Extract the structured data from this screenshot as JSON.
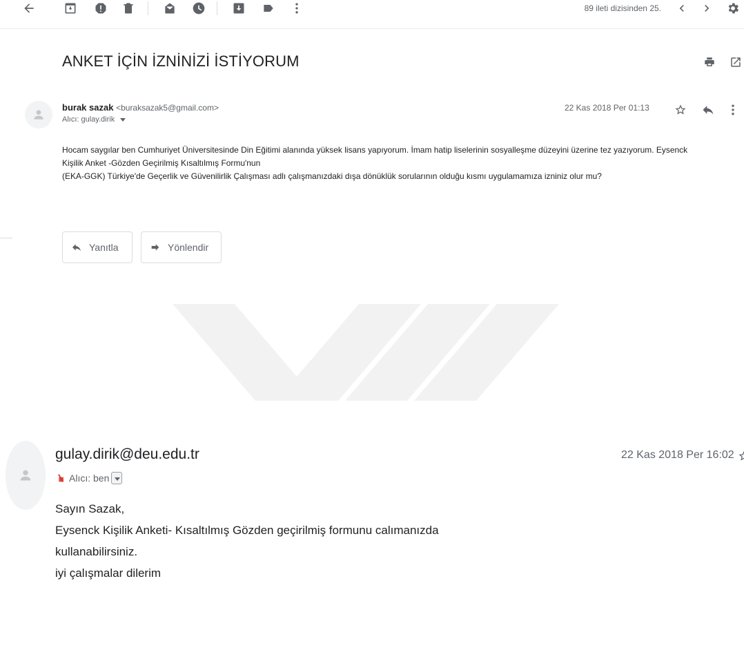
{
  "toolbar": {
    "icons": [
      "back-arrow-icon",
      "archive-icon",
      "report-spam-icon",
      "delete-icon",
      "mark-unread-icon",
      "snooze-icon",
      "move-to-icon",
      "label-icon",
      "more-vert-icon"
    ],
    "counter": "89 ileti dizisinden 25.",
    "prev_icon": "chevron-left-icon",
    "next_icon": "chevron-right-icon",
    "settings_icon": "gear-icon"
  },
  "thread": {
    "subject": "ANKET İÇİN İZNİNİZİ İSTİYORUM",
    "print_icon": "print-icon",
    "open_new_window_icon": "open-in-new-icon"
  },
  "message1": {
    "sender_name": "burak sazak",
    "sender_email": "<buraksazak5@gmail.com>",
    "to": "Alıcı: gulay.dirik",
    "date": "22 Kas 2018 Per 01:13",
    "body_lines": [
      "Hocam saygılar ben Cumhuriyet Üniversitesinde Din Eğitimi alanında yüksek lisans yapıyorum. İmam hatip liselerinin sosyalleşme düzeyini üzerine tez yazıyorum. Eysenck",
      "Kişilik Anket -Gözden Geçirilmiş Kısaltılmış Formu'nun",
      "(EKA-GGK) Türkiye'de Geçerlik ve Güvenilirlik Çalışması adlı çalışmanızdaki dışa dönüklük sorularının olduğu kısmı uygulamamıza izniniz olur mu?"
    ],
    "reply_label": "Yanıtla",
    "forward_label": "Yönlendir"
  },
  "message2": {
    "sender": "gulay.dirik@deu.edu.tr",
    "to": "Alıcı: ben",
    "date": "22 Kas 2018 Per 16:02",
    "body_lines": [
      "Sayın Sazak,",
      "Eysenck Kişilik Anketi- Kısaltılmış Gözden geçirilmiş formunu calımanızda",
      "kullanabilirsiniz.",
      "iyi çalışmalar dilerim"
    ]
  },
  "colors": {
    "icon": "#5f6368",
    "text": "#202124",
    "watermark": "#f2f2f2"
  }
}
